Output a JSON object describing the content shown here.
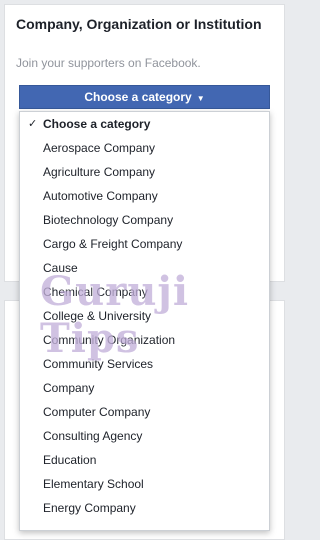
{
  "section": {
    "title": "Company, Organization or Institution",
    "subtitle": "Join your supporters on Facebook."
  },
  "category_select": {
    "label": "Choose a category",
    "caret": "▼"
  },
  "dropdown": {
    "selected_mark": "✓",
    "options": [
      "Choose a category",
      "Aerospace Company",
      "Agriculture Company",
      "Automotive Company",
      "Biotechnology Company",
      "Cargo & Freight Company",
      "Cause",
      "Chemical Company",
      "College & University",
      "Community Organization",
      "Community Services",
      "Company",
      "Computer Company",
      "Consulting Agency",
      "Education",
      "Elementary School",
      "Energy Company"
    ]
  },
  "watermark": "Guruji Tips",
  "colors": {
    "button_blue": "#4267b2",
    "page_bg": "#e9ebee"
  }
}
